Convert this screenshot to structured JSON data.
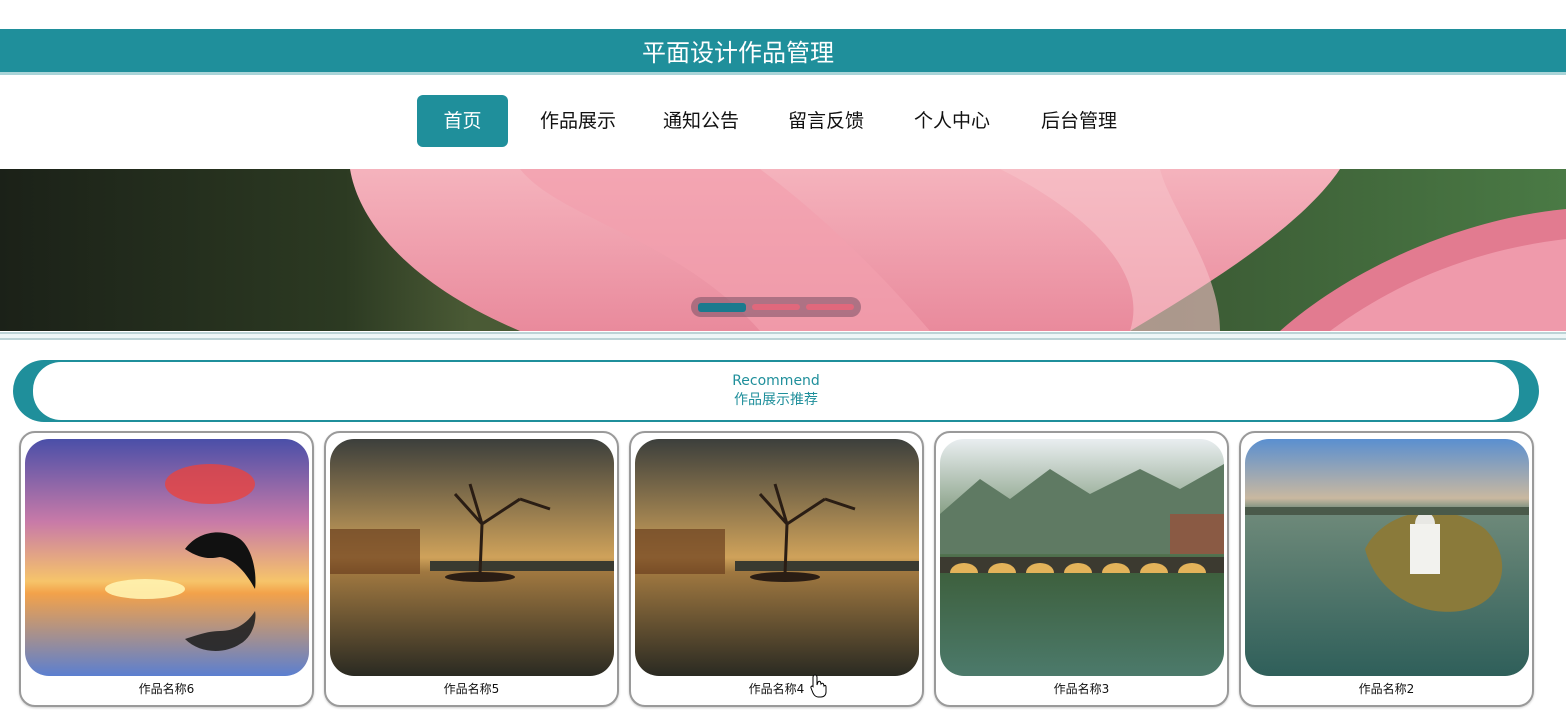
{
  "header": {
    "title": "平面设计作品管理"
  },
  "nav": {
    "items": [
      {
        "label": "首页",
        "active": true
      },
      {
        "label": "作品展示",
        "active": false
      },
      {
        "label": "通知公告",
        "active": false
      },
      {
        "label": "留言反馈",
        "active": false
      },
      {
        "label": "个人中心",
        "active": false
      },
      {
        "label": "后台管理",
        "active": false
      }
    ]
  },
  "carousel": {
    "slide_count": 3,
    "active_index": 0
  },
  "recommend": {
    "title_en": "Recommend",
    "title_cn": "作品展示推荐"
  },
  "works": [
    {
      "name": "作品名称6",
      "image": "dolphin-sunset"
    },
    {
      "name": "作品名称5",
      "image": "lone-tree-lake"
    },
    {
      "name": "作品名称4",
      "image": "lone-tree-lake"
    },
    {
      "name": "作品名称3",
      "image": "stone-bridge-river"
    },
    {
      "name": "作品名称2",
      "image": "lake-island-castle"
    }
  ],
  "colors": {
    "accent": "#1f8f9b",
    "dot_inactive": "#e0687c",
    "dot_active": "#1a7a8e"
  }
}
